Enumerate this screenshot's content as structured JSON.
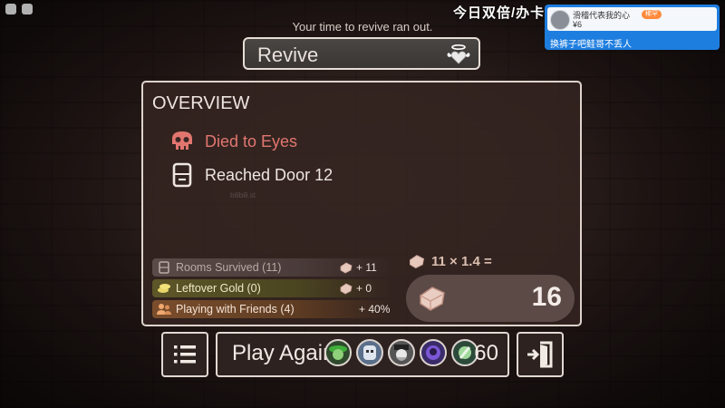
{
  "top_banner": "今日双倍/办卡",
  "notice": "Your time to revive ran out.",
  "revive": {
    "label": "Revive"
  },
  "overview": {
    "title": "OVERVIEW",
    "cause": "Died to Eyes",
    "door": "Reached Door 12",
    "watermark": "bilibili.st"
  },
  "stats": [
    {
      "label": "Rooms Survived (11)",
      "value": "+ 11",
      "icon": "door-icon"
    },
    {
      "label": "Leftover Gold (0)",
      "value": "+ 0",
      "icon": "gold-icon"
    },
    {
      "label": "Playing with Friends (4)",
      "value": "+ 40%",
      "icon": "friends-icon"
    }
  ],
  "multiplier": "11 × 1.4 =",
  "total": "16",
  "play_again": {
    "label": "Play Again",
    "timer": "60"
  },
  "chat": {
    "name": "滑稽代表我的心",
    "badge": "稀罕",
    "amount": "¥6",
    "message": "换裤子吧鲑哥不丢人"
  },
  "colors": {
    "accent_red": "#e2766f",
    "panel_border": "#ded3cc",
    "chat_blue": "#1e7ee0"
  }
}
